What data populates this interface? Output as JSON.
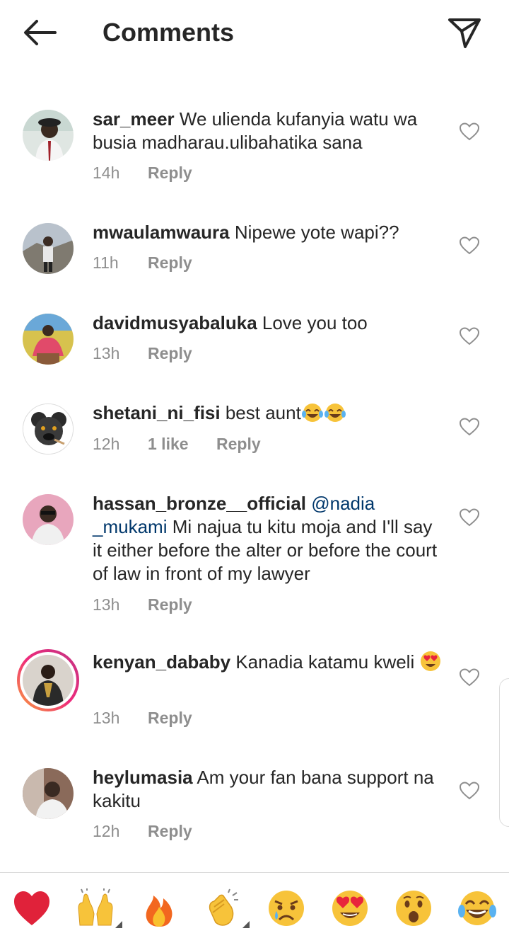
{
  "header": {
    "title": "Comments",
    "back_icon": "back-arrow-icon",
    "send_icon": "paper-plane-icon"
  },
  "comments": [
    {
      "username": "sar_meer",
      "text": " We ulienda kufanyia watu wa busia madharau.ulibahatika sana",
      "time": "14h",
      "reply": "Reply"
    },
    {
      "username": "mwaulamwaura",
      "text": " Nipewe yote wapi??",
      "time": "11h",
      "reply": "Reply"
    },
    {
      "username": "davidmusyabaluka",
      "text": " Love you too",
      "time": "13h",
      "reply": "Reply"
    },
    {
      "username": "shetani_ni_fisi",
      "text": " best aunt",
      "time": "12h",
      "likes": "1 like",
      "reply": "Reply"
    },
    {
      "username": "hassan_bronze__official",
      "mention": "@nadia _mukami",
      "text": " Mi najua tu kitu moja and I'll say it either before the alter or before the court of law in front of my lawyer",
      "time": "13h",
      "reply": "Reply"
    },
    {
      "username": "kenyan_dababy",
      "text": " Kanadia katamu kweli ",
      "time": "13h",
      "reply": "Reply"
    },
    {
      "username": "heylumasia",
      "text": " Am your fan bana support na kakitu",
      "time": "12h",
      "reply": "Reply"
    }
  ],
  "reactions": [
    "red-heart-icon",
    "raised-hands-icon",
    "fire-icon",
    "clapping-hands-icon",
    "crying-face-icon",
    "heart-eyes-icon",
    "surprised-face-icon",
    "tears-of-joy-icon"
  ],
  "colors": {
    "text": "#262626",
    "secondary": "#8e8e8e",
    "mention": "#00376b",
    "story_ring_start": "#f9a13b",
    "story_ring_end": "#c13584"
  }
}
